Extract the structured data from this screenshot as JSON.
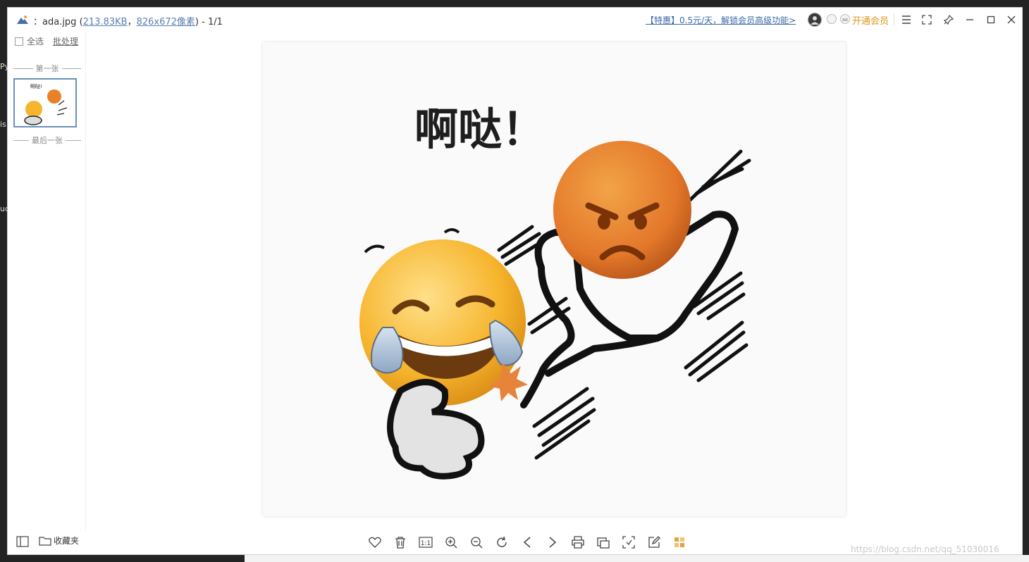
{
  "window": {
    "title_prefix": "：ada.jpg (",
    "file_size": "213.83KB",
    "title_sep": "，",
    "dimensions": "826x672像素",
    "title_suffix": ") - 1/1",
    "promo": "【特惠】0.5元/天，解锁会员高级功能>",
    "vip_label": "开通会员"
  },
  "left_panel": {
    "select_all": "全选",
    "batch": "批处理",
    "first_label": "第一张",
    "last_label": "最后一张"
  },
  "image": {
    "caption": "啊哒！",
    "thumb_caption": "啊哒!"
  },
  "bottom": {
    "favorites": "收藏夹",
    "tools": [
      "heart-icon",
      "trash-icon",
      "actual-size-icon",
      "zoom-in-icon",
      "zoom-out-icon",
      "rotate-icon",
      "prev-icon",
      "next-icon",
      "print-icon",
      "copy-icon",
      "crop-icon",
      "edit-icon",
      "apps-icon"
    ],
    "actual_size_label": "1:1",
    "watermark": "https://blog.csdn.net/qq_51030016"
  },
  "colors": {
    "accent_link": "#3b6aa8",
    "vip": "#e0961c",
    "thumb_border": "#6b8fbf"
  }
}
